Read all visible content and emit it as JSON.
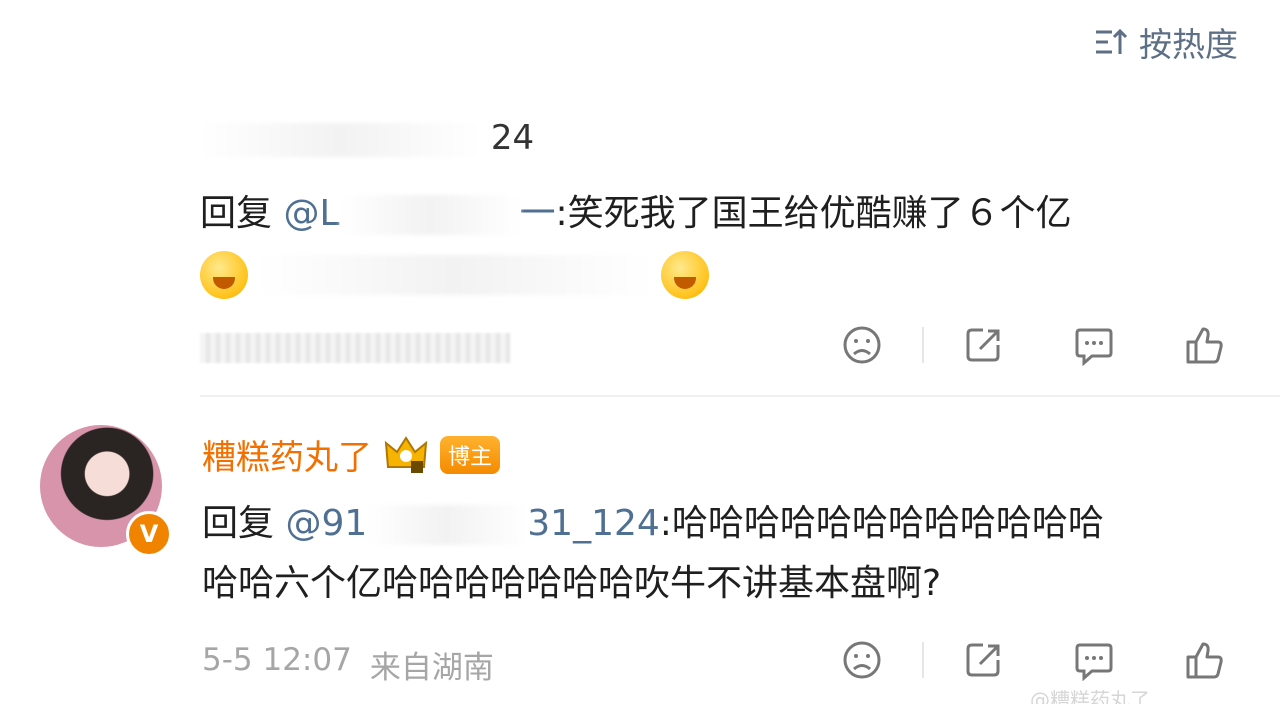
{
  "sort": {
    "label": "按热度",
    "icon": "sort-icon"
  },
  "comment1": {
    "username_visible": "24",
    "reply_prefix": "回复 ",
    "mention_visible_start": "@L",
    "mention_visible_end": "一",
    "text": ":笑死我了国王给优酷赚了６个亿",
    "emoji_left": "emoji-smirk",
    "emoji_right": "emoji-laugh-cry"
  },
  "comment2": {
    "username": "糟糕药丸了",
    "badge": "博主",
    "reply_prefix": "回复 ",
    "mention_visible_start": "@91",
    "mention_visible_end": "31_124",
    "text_line1": ":哈哈哈哈哈哈哈哈哈哈哈哈",
    "text_line2": "哈哈六个亿哈哈哈哈哈哈哈吹牛不讲基本盘啊?",
    "date": "5-5 12:07",
    "location": "来自湖南"
  },
  "watermark": "@糟糕药丸了"
}
